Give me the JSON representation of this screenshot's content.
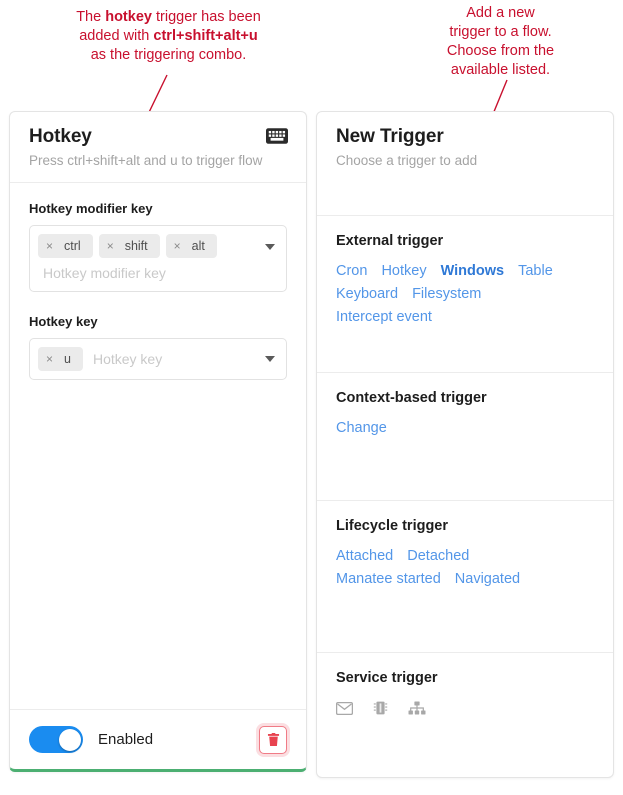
{
  "annotations": {
    "left": {
      "line1_pre": "The ",
      "line1_bold": "hotkey",
      "line1_post": " trigger has been",
      "line2_pre": "added with ",
      "line2_bold": "ctrl+shift+alt+u",
      "line3": "as the triggering combo."
    },
    "right": {
      "line1": "Add a new",
      "line2": "trigger to a flow.",
      "line3": "Choose from the",
      "line4": "available listed."
    },
    "color": "#c8102e"
  },
  "hotkey_card": {
    "title": "Hotkey",
    "subtitle": "Press ctrl+shift+alt and u to trigger flow",
    "header_icon": "keyboard-icon",
    "accent_color": "#4caf72",
    "modifier_field": {
      "label": "Hotkey modifier key",
      "chips": [
        "ctrl",
        "shift",
        "alt"
      ],
      "placeholder": "Hotkey modifier key",
      "chip_remove_icon": "×"
    },
    "key_field": {
      "label": "Hotkey key",
      "chips": [
        "u"
      ],
      "placeholder": "Hotkey key",
      "chip_remove_icon": "×"
    },
    "footer": {
      "toggle_state": "on",
      "toggle_label": "Enabled",
      "toggle_color": "#1a8cf0",
      "delete_icon": "trash-icon",
      "delete_color": "#e8434f"
    }
  },
  "new_trigger_card": {
    "title": "New Trigger",
    "subtitle": "Choose a trigger to add",
    "sections": [
      {
        "title": "External trigger",
        "links": [
          "Cron",
          "Hotkey",
          "Windows",
          "Table",
          "Keyboard",
          "Filesystem",
          "Intercept event"
        ],
        "highlighted": "Windows"
      },
      {
        "title": "Context-based trigger",
        "links": [
          "Change"
        ]
      },
      {
        "title": "Lifecycle trigger",
        "links": [
          "Attached",
          "Detached",
          "Manatee started",
          "Navigated"
        ]
      },
      {
        "title": "Service trigger",
        "icons": [
          "mail-icon",
          "chip-icon",
          "sitemap-icon"
        ]
      }
    ],
    "link_color": "#5396e8"
  }
}
